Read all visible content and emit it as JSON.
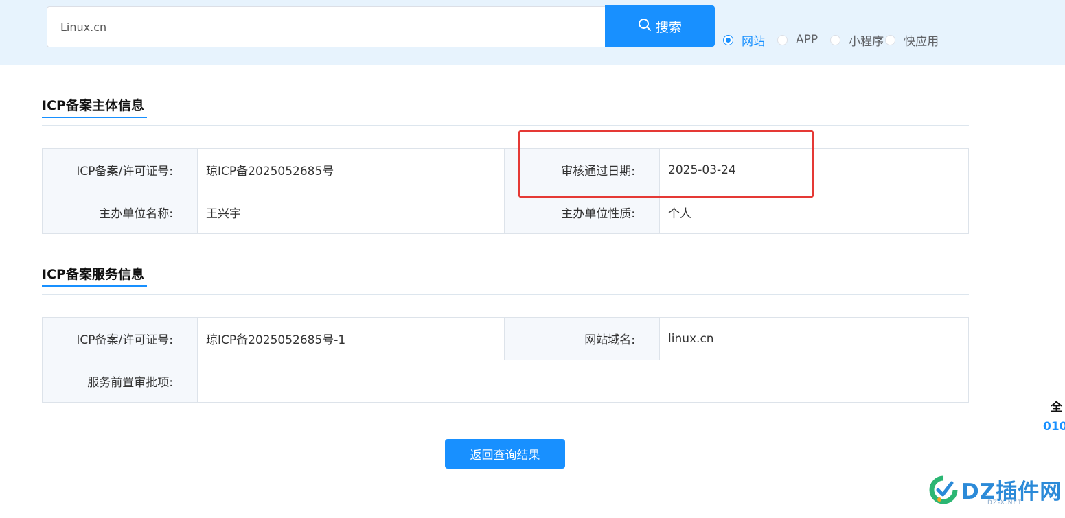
{
  "search": {
    "value": "Linux.cn",
    "button_label": "搜索"
  },
  "type_options": [
    {
      "label": "网站",
      "checked": true
    },
    {
      "label": "APP",
      "checked": false
    },
    {
      "label": "小程序",
      "checked": false
    },
    {
      "label": "快应用",
      "checked": false
    }
  ],
  "subject_section": {
    "title": "ICP备案主体信息",
    "rows": [
      {
        "k1": "ICP备案/许可证号:",
        "v1": "琼ICP备2025052685号",
        "k2": "审核通过日期:",
        "v2": "2025-03-24"
      },
      {
        "k1": "主办单位名称:",
        "v1": "王兴宇",
        "k2": "主办单位性质:",
        "v2": "个人"
      }
    ]
  },
  "service_section": {
    "title": "ICP备案服务信息",
    "row1": {
      "k1": "ICP备案/许可证号:",
      "v1": "琼ICP备2025052685号-1",
      "k2": "网站域名:",
      "v2": "linux.cn"
    },
    "row2": {
      "k1": "服务前置审批项:",
      "v1": ""
    }
  },
  "back_button_label": "返回查询结果",
  "side_card": {
    "line1": "全",
    "line2": "010"
  },
  "watermark": {
    "text": "DZ插件网",
    "sub": "DZ-X.NET"
  },
  "colors": {
    "accent": "#1890ff",
    "highlight": "#e53935",
    "topbar_bg": "#e7f3fd"
  }
}
